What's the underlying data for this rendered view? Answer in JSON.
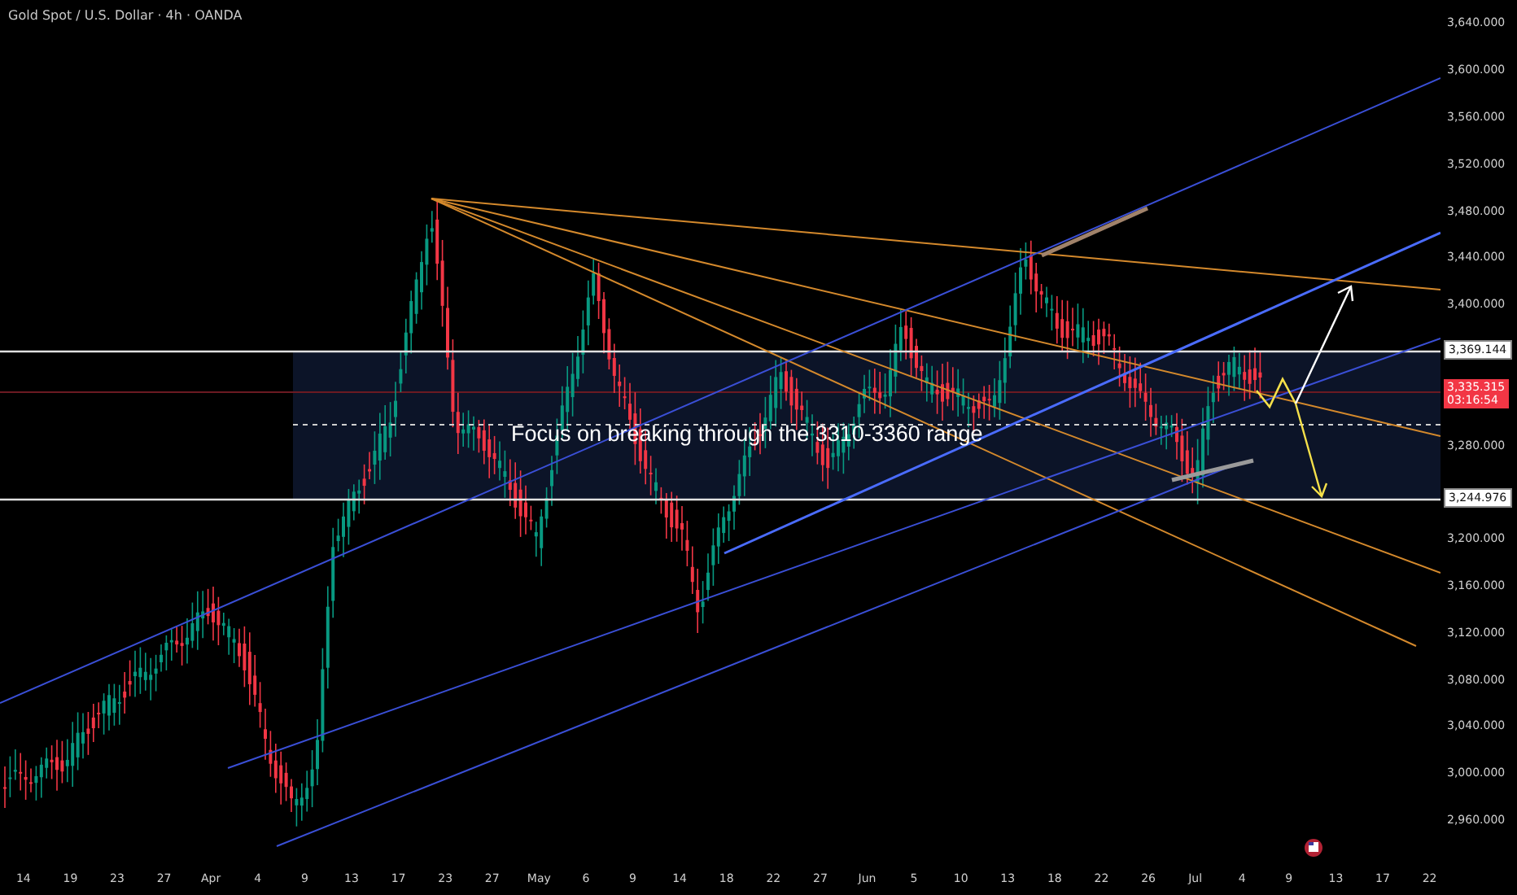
{
  "title": "Gold Spot / U.S. Dollar · 4h · OANDA",
  "annotation": "Focus on breaking through the 3310-3360 range",
  "price_axis": {
    "labels": [
      "3,640.000",
      "3,600.000",
      "3,560.000",
      "3,520.000",
      "3,480.000",
      "3,440.000",
      "3,400.000",
      "3,280.000",
      "3,200.000",
      "3,160.000",
      "3,120.000",
      "3,080.000",
      "3,040.000",
      "3,000.000",
      "2,960.000"
    ]
  },
  "price_markers": [
    {
      "kind": "level",
      "price": "3,369.144"
    },
    {
      "kind": "last",
      "price": "3,335.315",
      "countdown": "03:16:54"
    },
    {
      "kind": "level",
      "price": "3,244.976"
    }
  ],
  "time_axis": {
    "labels": [
      "14",
      "19",
      "23",
      "27",
      "Apr",
      "4",
      "9",
      "13",
      "17",
      "23",
      "27",
      "May",
      "6",
      "9",
      "14",
      "18",
      "22",
      "27",
      "Jun",
      "5",
      "10",
      "13",
      "18",
      "22",
      "26",
      "Jul",
      "4",
      "9",
      "13",
      "17",
      "22"
    ]
  }
}
